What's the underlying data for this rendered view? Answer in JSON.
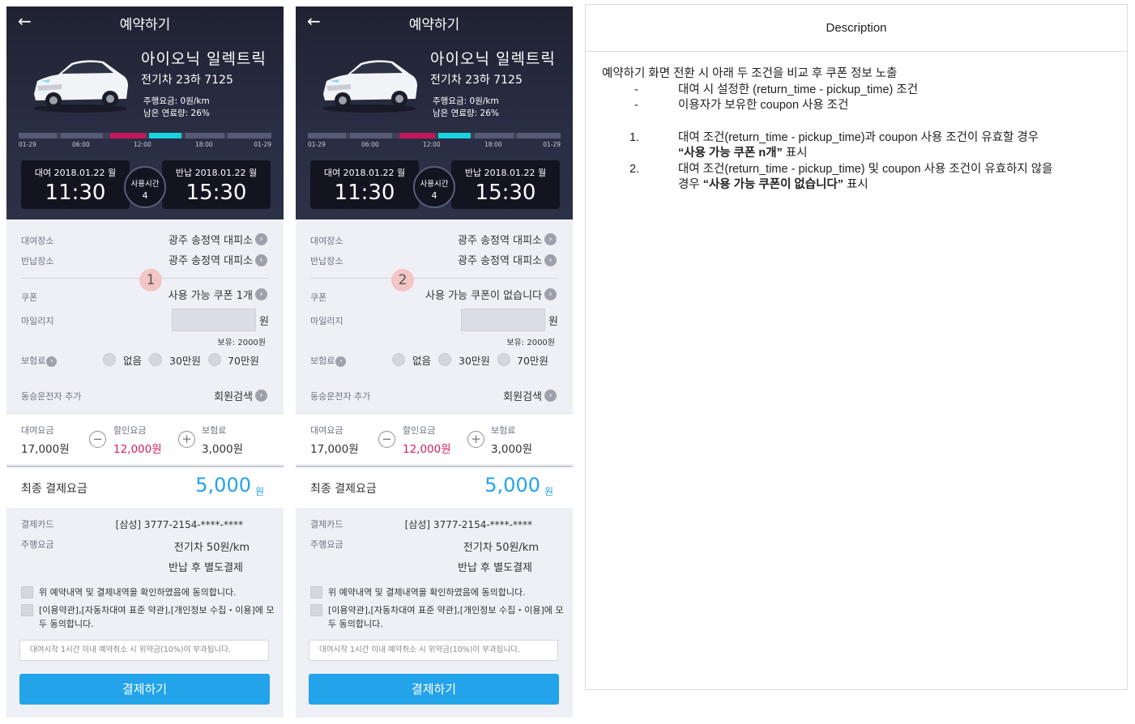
{
  "phones": [
    {
      "header_title": "예약하기",
      "car_name": "아이오닉 일렉트릭",
      "car_plate": "전기차 23하 7125",
      "drive_fee": "주행요금: 0원/km",
      "fuel_left": "남은 연료량: 26%",
      "ticks": [
        "01-29",
        "06:00",
        "12:00",
        "18:00",
        "01-29"
      ],
      "rent_label": "대여  2018.01.22 월",
      "rent_time": "11:30",
      "use_label": "사용시간",
      "use_value": "4",
      "return_label": "반납  2018.01.22 월",
      "return_time": "15:30",
      "pickup_label": "대여장소",
      "pickup_value": "광주 송정역 대피소",
      "dropoff_label": "반납장소",
      "dropoff_value": "광주 송정역 대피소",
      "badge": "1",
      "coupon_label": "쿠폰",
      "coupon_value": "사용 가능 쿠폰 1개",
      "mileage_label": "마일리지",
      "won": "원",
      "hold": "보유: 2000원",
      "insurance_label": "보험료",
      "ins_opt1": "없음",
      "ins_opt2": "30만원",
      "ins_opt3": "70만원",
      "co_driver_label": "동승운전자 추가",
      "co_driver_value": "회원검색",
      "rent_fee_label": "대여요금",
      "rent_fee_value": "17,000원",
      "minus": "−",
      "discount_label": "할인요금",
      "discount_value": "12,000원",
      "plus": "+",
      "insurance_fee_label": "보험료",
      "insurance_fee_value": "3,000원",
      "total_label": "최종 결제요금",
      "total_value": "5,000",
      "total_unit": "원",
      "card_label": "결제카드",
      "card_value": "[삼성] 3777-2154-****-****",
      "drive_label": "주행요금",
      "drive_value": "전기차 50원/km",
      "settle_value": "반납 후 별도결제",
      "agree1": "위 예약내역 및 결제내역을 확인하였음에 동의합니다.",
      "agree2": "[이용약관],[자동차대여 표준 약관],[개인정보 수집・이용]에 모두 동의합니다.",
      "notice": "대여시작 1시간 이내 예약취소 시 위약금(10%)이 부과됩니다.",
      "pay_button": "결제하기"
    },
    {
      "header_title": "예약하기",
      "car_name": "아이오닉 일렉트릭",
      "car_plate": "전기차 23하 7125",
      "drive_fee": "주행요금: 0원/km",
      "fuel_left": "남은 연료량: 26%",
      "ticks": [
        "01-29",
        "06:00",
        "12:00",
        "18:00",
        "01-29"
      ],
      "rent_label": "대여  2018.01.22 월",
      "rent_time": "11:30",
      "use_label": "사용시간",
      "use_value": "4",
      "return_label": "반납  2018.01.22 월",
      "return_time": "15:30",
      "pickup_label": "대여장소",
      "pickup_value": "광주 송정역 대피소",
      "dropoff_label": "반납장소",
      "dropoff_value": "광주 송정역 대피소",
      "badge": "2",
      "coupon_label": "쿠폰",
      "coupon_value": "사용 가능 쿠폰이 없습니다",
      "mileage_label": "마일리지",
      "won": "원",
      "hold": "보유: 2000원",
      "insurance_label": "보험료",
      "ins_opt1": "없음",
      "ins_opt2": "30만원",
      "ins_opt3": "70만원",
      "co_driver_label": "동승운전자 추가",
      "co_driver_value": "회원검색",
      "rent_fee_label": "대여요금",
      "rent_fee_value": "17,000원",
      "minus": "−",
      "discount_label": "할인요금",
      "discount_value": "12,000원",
      "plus": "+",
      "insurance_fee_label": "보험료",
      "insurance_fee_value": "3,000원",
      "total_label": "최종 결제요금",
      "total_value": "5,000",
      "total_unit": "원",
      "card_label": "결제카드",
      "card_value": "[삼성] 3777-2154-****-****",
      "drive_label": "주행요금",
      "drive_value": "전기차 50원/km",
      "settle_value": "반납 후 별도결제",
      "agree1": "위 예약내역 및 결제내역을 확인하였음에 동의합니다.",
      "agree2": "[이용약관],[자동차대여 표준 약관],[개인정보 수집・이용]에 모두 동의합니다.",
      "notice": "대여시작 1시간 이내 예약취소 시 위약금(10%)이 부과됩니다.",
      "pay_button": "결제하기"
    }
  ],
  "description": {
    "title": "Description",
    "intro": "예약하기 화면 전환 시 아래 두 조건을 비교 후 쿠폰 정보 노출",
    "bullet_mark": "-",
    "bullet1": "대여 시 설정한 (return_time - pickup_time) 조건",
    "bullet2": "이용자가 보유한 coupon 사용 조건",
    "item1_num": "1.",
    "item1_line1": "대여 조건(return_time - pickup_time)과 coupon 사용 조건이 유효할 경우",
    "item1_bold": "“사용 가능 쿠폰 n개”",
    "item1_tail": " 표시",
    "item2_num": "2.",
    "item2_line1": "대여 조건(return_time - pickup_time) 및 coupon 사용 조건이 유효하지 않을",
    "item2_pre": "경우 ",
    "item2_bold": "“사용 가능 쿠폰이 없습니다”",
    "item2_tail": " 표시"
  },
  "colors": {
    "accent": "#23a3ea",
    "discount": "#d81b60",
    "header_bg": "#1f2232",
    "timeline_pink": "#c2185b",
    "timeline_cyan": "#19d3df"
  }
}
